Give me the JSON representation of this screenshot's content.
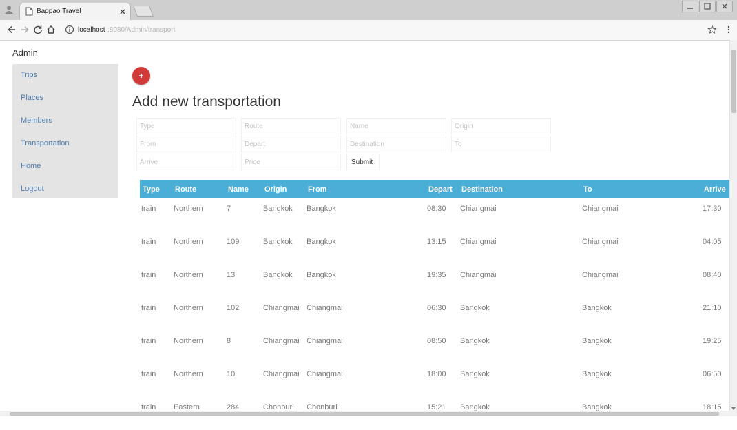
{
  "browser": {
    "tab_title": "Bagpao Travel",
    "url_host": "localhost",
    "url_path": ":8080/Admin/transport",
    "icons": [
      "profile-icon",
      "page-icon",
      "close-icon",
      "back-arrow-icon",
      "forward-arrow-icon",
      "reload-icon",
      "home-icon",
      "info-icon",
      "star-icon",
      "menu-icon"
    ]
  },
  "page": {
    "admin_label": "Admin",
    "heading": "Add new transportation"
  },
  "sidebar": {
    "items": [
      {
        "label": "Trips"
      },
      {
        "label": "Places"
      },
      {
        "label": "Members"
      },
      {
        "label": "Transportation"
      },
      {
        "label": "Home"
      },
      {
        "label": "Logout"
      }
    ]
  },
  "form": {
    "fields": [
      {
        "placeholder": "Type"
      },
      {
        "placeholder": "Route"
      },
      {
        "placeholder": "Name"
      },
      {
        "placeholder": "Origin"
      },
      {
        "placeholder": "From"
      },
      {
        "placeholder": "Depart"
      },
      {
        "placeholder": "Destination"
      },
      {
        "placeholder": "To"
      },
      {
        "placeholder": "Arrive"
      },
      {
        "placeholder": "Price"
      }
    ],
    "submit_label": "Submit"
  },
  "table": {
    "headers": [
      "Type",
      "Route",
      "Name",
      "Origin",
      "From",
      "Depart",
      "Destination",
      "To",
      "Arrive"
    ],
    "rows": [
      [
        "train",
        "Northern",
        "7",
        "Bangkok",
        "Bangkok",
        "08:30",
        "Chiangmai",
        "Chiangmai",
        "17:30"
      ],
      [
        "train",
        "Northern",
        "109",
        "Bangkok",
        "Bangkok",
        "13:15",
        "Chiangmai",
        "Chiangmai",
        "04:05"
      ],
      [
        "train",
        "Northern",
        "13",
        "Bangkok",
        "Bangkok",
        "19:35",
        "Chiangmai",
        "Chiangmai",
        "08:40"
      ],
      [
        "train",
        "Northern",
        "102",
        "Chiangmai",
        "Chiangmai",
        "06:30",
        "Bangkok",
        "Bangkok",
        "21:10"
      ],
      [
        "train",
        "Northern",
        "8",
        "Chiangmai",
        "Chiangmai",
        "08:50",
        "Bangkok",
        "Bangkok",
        "19:25"
      ],
      [
        "train",
        "Northern",
        "10",
        "Chiangmai",
        "Chiangmai",
        "18:00",
        "Bangkok",
        "Bangkok",
        "06:50"
      ],
      [
        "train",
        "Eastern",
        "284",
        "Chonburi",
        "Chonburi",
        "15:21",
        "Bangkok",
        "Bangkok",
        "18:15"
      ]
    ]
  },
  "colors": {
    "table_header_bg": "#4aaed6",
    "add_button": "#d23a3a",
    "sidebar_bg": "#e4e4e4",
    "sidebar_link": "#4f7cab"
  }
}
